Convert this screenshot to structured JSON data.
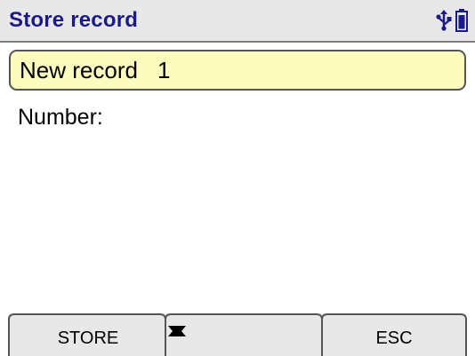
{
  "titlebar": {
    "title": "Store record",
    "icons": [
      "usb-icon",
      "battery-icon"
    ],
    "title_color": "#1a1a8c"
  },
  "record": {
    "label": "New record",
    "number": "1",
    "highlight_color": "#fcfcbe"
  },
  "fields": {
    "number_label": "Number:"
  },
  "softkeys": {
    "left_label": "STORE",
    "middle_icons": [
      "arrow-up-icon",
      "arrow-down-icon"
    ],
    "right_label": "ESC"
  }
}
